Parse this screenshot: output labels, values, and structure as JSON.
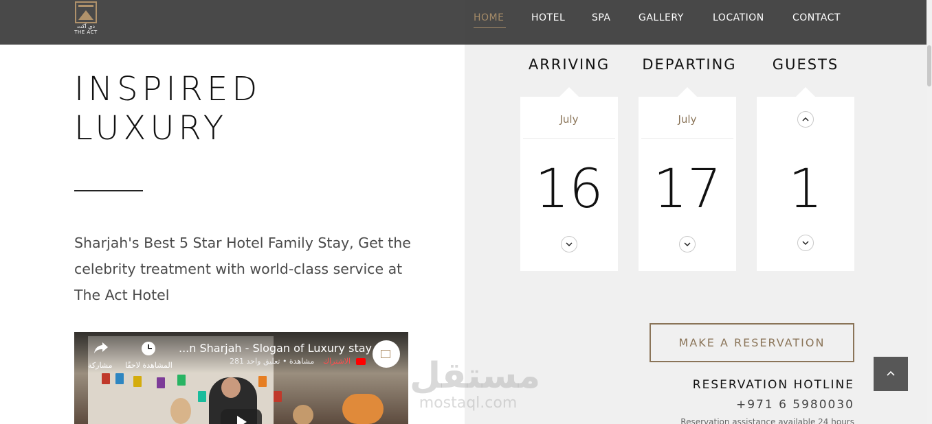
{
  "header": {
    "logo_ar": "دي آكت",
    "logo_en": "THE ACT",
    "nav": [
      {
        "label": "HOME",
        "active": true
      },
      {
        "label": "HOTEL",
        "active": false
      },
      {
        "label": "SPA",
        "active": false
      },
      {
        "label": "GALLERY",
        "active": false
      },
      {
        "label": "LOCATION",
        "active": false
      },
      {
        "label": "CONTACT",
        "active": false
      }
    ]
  },
  "hero": {
    "title_line1": "INSPIRED",
    "title_line2": "LUXURY",
    "description": "Sharjah's Best 5 Star Hotel Family Stay, Get the celebrity treatment with world-class service at The Act Hotel"
  },
  "video": {
    "title": "...n Sharjah - Slogan of Luxury stay",
    "meta": "281 مشاهدة • تعليق واحد",
    "subscribe": "الاشتراك",
    "share_label": "مشاركة",
    "watch_later_label": "المشاهدة لاحقًا"
  },
  "booking": {
    "arriving": {
      "heading": "ARRIVING",
      "month": "July",
      "day": "16"
    },
    "departing": {
      "heading": "DEPARTING",
      "month": "July",
      "day": "17"
    },
    "guests": {
      "heading": "GUESTS",
      "count": "1"
    },
    "reserve_label": "MAKE A RESERVATION",
    "hotline_title": "RESERVATION HOTLINE",
    "hotline_phone": "+971 6 5980030",
    "hotline_note": "Reservation assistance available 24 hours"
  },
  "watermark": {
    "ar": "مستقل",
    "en": "mostaql.com"
  },
  "colors": {
    "accent": "#8a7458",
    "nav_bg": "#3a3a3a",
    "panel_bg": "#f0f0f0"
  }
}
